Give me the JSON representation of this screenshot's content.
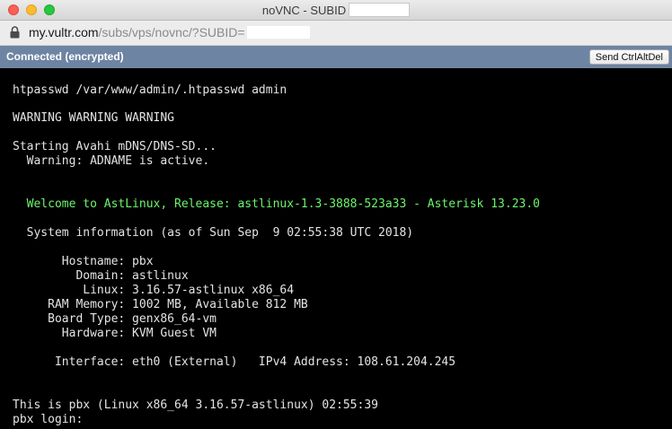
{
  "window": {
    "title": "noVNC - SUBID"
  },
  "address_bar": {
    "host": "my.vultr.com",
    "path": "/subs/vps/novnc/?SUBID="
  },
  "vnc_status": {
    "status_text": "Connected (encrypted)",
    "ctrl_alt_del_label": "Send CtrlAltDel",
    "bar_color": "#6e84a3"
  },
  "console": {
    "lines": [
      "htpasswd /var/www/admin/.htpasswd admin",
      "WARNING WARNING WARNING",
      "Starting Avahi mDNS/DNS-SD...",
      "  Warning: ADNAME is active.",
      "  Welcome to AstLinux, Release: astlinux-1.3-3888-523a33 - Asterisk 13.23.0",
      "  System information (as of Sun Sep  9 02:55:38 UTC 2018)",
      "       Hostname: pbx",
      "         Domain: astlinux",
      "          Linux: 3.16.57-astlinux x86_64",
      "     RAM Memory: 1002 MB, Available 812 MB",
      "     Board Type: genx86_64-vm",
      "       Hardware: KVM Guest VM",
      "      Interface: eth0 (External)   IPv4 Address: 108.61.204.245",
      "This is pbx (Linux x86_64 3.16.57-astlinux) 02:55:39",
      "pbx login:"
    ],
    "welcome_color": "#6cf56c",
    "text_color": "#e4e4e4"
  }
}
